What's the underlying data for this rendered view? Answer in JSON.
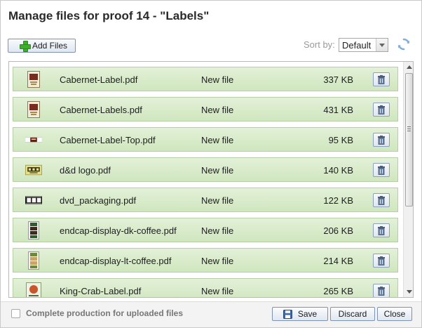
{
  "dialog": {
    "title": "Manage files for proof 14 - \"Labels\""
  },
  "toolbar": {
    "add_files_label": "Add Files",
    "sort_by_label": "Sort by:",
    "sort_value": "Default"
  },
  "files": [
    {
      "name": "Cabernet-Label.pdf",
      "status": "New file",
      "size": "337 KB",
      "thumb": "wine-label-thumbnail"
    },
    {
      "name": "Cabernet-Labels.pdf",
      "status": "New file",
      "size": "431 KB",
      "thumb": "wine-label-thumbnail"
    },
    {
      "name": "Cabernet-Label-Top.pdf",
      "status": "New file",
      "size": "95 KB",
      "thumb": "label-top-thumbnail"
    },
    {
      "name": "d&d logo.pdf",
      "status": "New file",
      "size": "140 KB",
      "thumb": "logo-thumbnail"
    },
    {
      "name": "dvd_packaging.pdf",
      "status": "New file",
      "size": "122 KB",
      "thumb": "film-strip-thumbnail"
    },
    {
      "name": "endcap-display-dk-coffee.pdf",
      "status": "New file",
      "size": "206 KB",
      "thumb": "display-stand-thumbnail"
    },
    {
      "name": "endcap-display-lt-coffee.pdf",
      "status": "New file",
      "size": "214 KB",
      "thumb": "display-stand-thumbnail"
    },
    {
      "name": "King-Crab-Label.pdf",
      "status": "New file",
      "size": "265 KB",
      "thumb": "crab-label-thumbnail"
    }
  ],
  "footer": {
    "complete_production_label": "Complete production for uploaded files",
    "complete_production_checked": false,
    "save_label": "Save",
    "discard_label": "Discard",
    "close_label": "Close"
  },
  "colors": {
    "row_fill": "#d9ecc9",
    "row_border": "#b6cfa6",
    "button_border": "#7d93b2",
    "add_icon": "#3fae2a",
    "refresh_icon": "#6fa6d6"
  }
}
